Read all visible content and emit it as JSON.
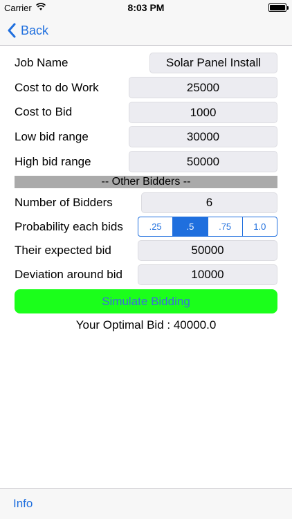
{
  "status_bar": {
    "carrier": "Carrier",
    "time": "8:03 PM",
    "wifi_icon": "wifi-icon",
    "battery_icon": "battery-icon"
  },
  "nav": {
    "back_label": "Back",
    "back_icon": "chevron-left-icon"
  },
  "form": {
    "job_name_label": "Job Name",
    "job_name_value": "Solar Panel Install",
    "cost_work_label": "Cost to do Work",
    "cost_work_value": "25000",
    "cost_bid_label": "Cost to Bid",
    "cost_bid_value": "1000",
    "low_bid_label": "Low bid range",
    "low_bid_value": "30000",
    "high_bid_label": "High bid range",
    "high_bid_value": "50000"
  },
  "other_bidders": {
    "section_title": "-- Other Bidders --",
    "num_bidders_label": "Number of Bidders",
    "num_bidders_value": "6",
    "probability_label": "Probability each bids",
    "probability_options": [
      ".25",
      ".5",
      ".75",
      "1.0"
    ],
    "probability_selected": ".5",
    "expected_bid_label": "Their expected bid",
    "expected_bid_value": "50000",
    "deviation_label": "Deviation around bid",
    "deviation_value": "10000"
  },
  "actions": {
    "simulate_label": "Simulate Bidding",
    "simulate_color": "#1bff1b",
    "result_text": "Your Optimal Bid : 40000.0"
  },
  "toolbar": {
    "info_label": "Info"
  },
  "colors": {
    "accent": "#1f6fde",
    "field_bg": "#ececf1",
    "divider_bg": "#aaaaaa"
  }
}
